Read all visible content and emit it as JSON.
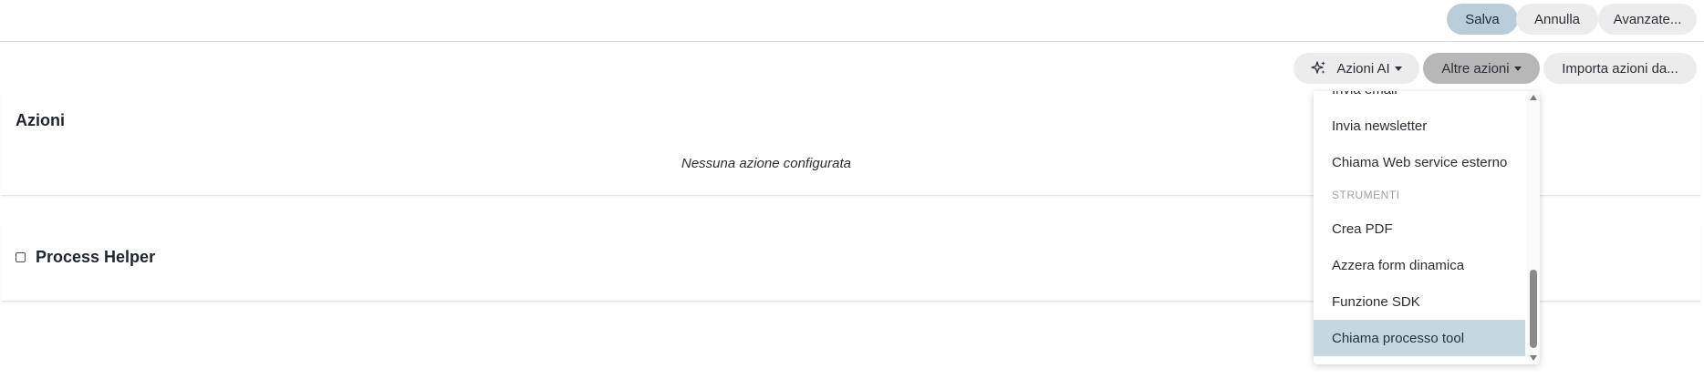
{
  "toolbar": {
    "save_label": "Salva",
    "cancel_label": "Annulla",
    "advanced_label": "Avanzate..."
  },
  "actions_bar": {
    "ai_actions_label": "Azioni AI",
    "other_actions_label": "Altre azioni",
    "import_actions_label": "Importa azioni da..."
  },
  "actions_card": {
    "title": "Azioni",
    "empty_text": "Nessuna azione configurata"
  },
  "process_helper": {
    "title": "Process Helper",
    "checked": false
  },
  "dropdown": {
    "partial_item": "Invia email",
    "items_top": [
      "Invia newsletter",
      "Chiama Web service esterno"
    ],
    "section_header": "STRUMENTI",
    "items_tools": [
      "Crea PDF",
      "Azzera form dinamica",
      "Funzione SDK",
      "Chiama processo tool"
    ],
    "highlighted_item": "Chiama processo tool"
  },
  "colors": {
    "primary_button": "#b9cdd9",
    "pressed_button": "#b7b7b7",
    "highlight_row": "#c5d7e0"
  }
}
